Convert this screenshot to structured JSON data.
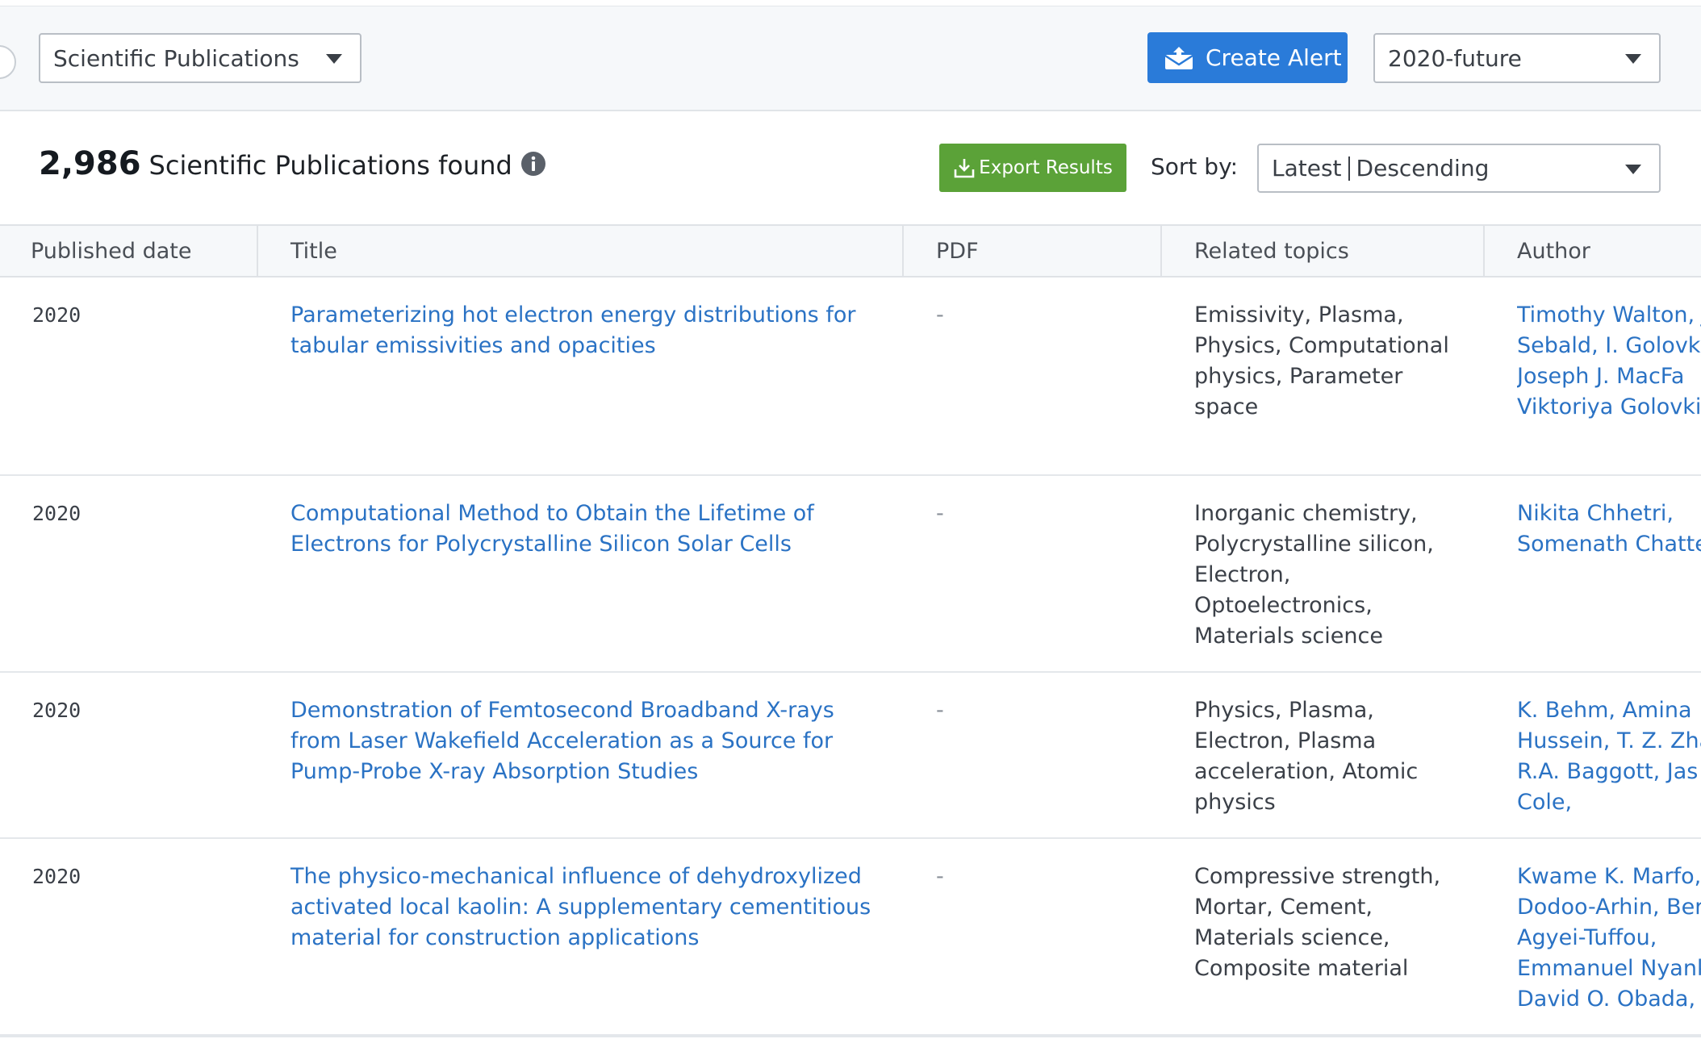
{
  "filters": {
    "source_label": "Scientific Publications",
    "create_alert_label": "Create Alert",
    "range_label": "2020-future"
  },
  "results": {
    "count": "2,986",
    "count_label": "Scientific Publications found",
    "export_label": "Export Results",
    "sort_label": "Sort by:",
    "sort_field": "Latest",
    "sort_order": "Descending"
  },
  "table": {
    "headers": {
      "date": "Published date",
      "title": "Title",
      "pdf": "PDF",
      "topics": "Related topics",
      "author": "Author"
    },
    "rows": [
      {
        "date": "2020",
        "title": "Parameterizing hot electron energy distributions for tabular emissivities and opacities",
        "pdf": "-",
        "topics": "Emissivity, Plasma, Physics, Computational physics, Parameter space",
        "author": [
          "Timothy Walton, J",
          "Sebald, I. Golovki",
          "Joseph J. MacFa",
          "Viktoriya Golovkir"
        ]
      },
      {
        "date": "2020",
        "title": "Computational Method to Obtain the Lifetime of Electrons for Polycrystalline Silicon Solar Cells",
        "pdf": "-",
        "topics": "Inorganic chemistry, Polycrystalline silicon, Electron, Optoelectronics, Materials science",
        "author": [
          "Nikita Chhetri,",
          "Somenath Chatte"
        ]
      },
      {
        "date": "2020",
        "title": "Demonstration of Femtosecond Broadband X-rays from Laser Wakefield Acceleration as a Source for Pump-Probe X-ray Absorption Studies",
        "pdf": "-",
        "topics": "Physics, Plasma, Electron, Plasma acceleration, Atomic physics",
        "author": [
          "K. Behm, Amina",
          "Hussein, T. Z. Zha",
          "R.A. Baggott, Jas",
          "Cole,"
        ]
      },
      {
        "date": "2020",
        "title": "The physico-mechanical influence of dehydroxylized activated local kaolin: A supplementary cementitious material for construction applications",
        "pdf": "-",
        "topics": "Compressive strength, Mortar, Cement, Materials science, Composite material",
        "author": [
          "Kwame K. Marfo,",
          "Dodoo-Arhin, Ber",
          "Agyei-Tuffou,",
          "Emmanuel Nyank",
          "David O. Obada,"
        ]
      }
    ]
  }
}
